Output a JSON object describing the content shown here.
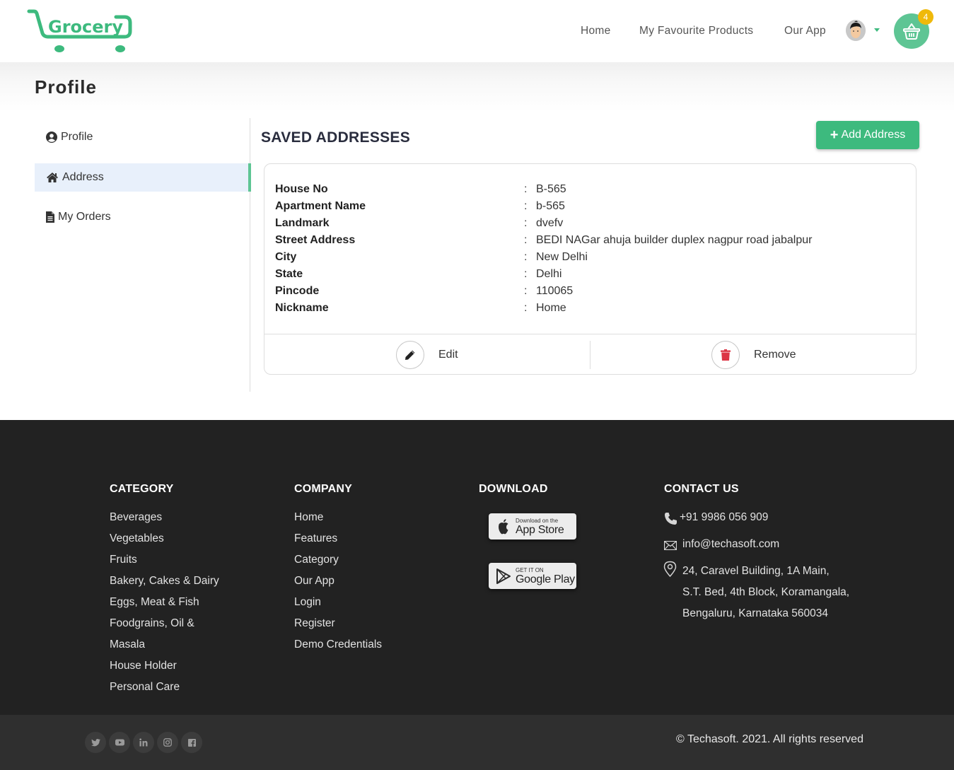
{
  "header": {
    "logo_text": "Grocery",
    "nav": [
      {
        "label": "Home"
      },
      {
        "label": "My Favourite Products"
      },
      {
        "label": "Our App"
      }
    ],
    "cart_count": "4",
    "brand_color": "#3dba7e",
    "badge_color": "#efb90b"
  },
  "page": {
    "title": "Profile"
  },
  "sidebar": {
    "items": [
      {
        "label": "Profile",
        "icon": "user-circle-icon",
        "active": false
      },
      {
        "label": "Address",
        "icon": "home-icon",
        "active": true
      },
      {
        "label": "My Orders",
        "icon": "file-icon",
        "active": false
      }
    ]
  },
  "main": {
    "section_title": "SAVED ADDRESSES",
    "add_button_label": "Add Address",
    "address": {
      "fields": [
        {
          "label": "House No",
          "value": "B-565"
        },
        {
          "label": "Apartment Name",
          "value": "b-565"
        },
        {
          "label": "Landmark",
          "value": "dvefv"
        },
        {
          "label": "Street Address",
          "value": "BEDI NAGar ahuja builder duplex nagpur road jabalpur"
        },
        {
          "label": "City",
          "value": "New Delhi"
        },
        {
          "label": "State",
          "value": "Delhi"
        },
        {
          "label": "Pincode",
          "value": "110065"
        },
        {
          "label": "Nickname",
          "value": "Home"
        }
      ],
      "separator": ":",
      "edit_label": "Edit",
      "remove_label": "Remove"
    }
  },
  "footer": {
    "category": {
      "heading": "CATEGORY",
      "links": [
        "Beverages",
        "Vegetables",
        "Fruits",
        "Bakery, Cakes & Dairy",
        "Eggs, Meat & Fish",
        "Foodgrains, Oil &",
        "Masala",
        "House Holder",
        "Personal Care"
      ]
    },
    "company": {
      "heading": "COMPANY",
      "links": [
        "Home",
        "Features",
        "Category",
        "Our App",
        "Login",
        "Register",
        "Demo Credentials"
      ]
    },
    "download": {
      "heading": "DOWNLOAD",
      "app_store": {
        "small": "Download on the",
        "big": "App Store"
      },
      "google_play": {
        "small": "GET IT ON",
        "big": "Google Play"
      }
    },
    "contact": {
      "heading": "CONTACT US",
      "phone": "+91 9986 056 909",
      "email": "info@techasoft.com",
      "address_lines": [
        "24, Caravel Building, 1A Main,",
        "S.T. Bed, 4th Block, Koramangala,",
        "Bengaluru, Karnataka 560034"
      ]
    },
    "social": [
      "twitter-icon",
      "youtube-icon",
      "linkedin-icon",
      "instagram-icon",
      "facebook-icon"
    ],
    "copyright": "© Techasoft. 2021. All rights reserved"
  }
}
